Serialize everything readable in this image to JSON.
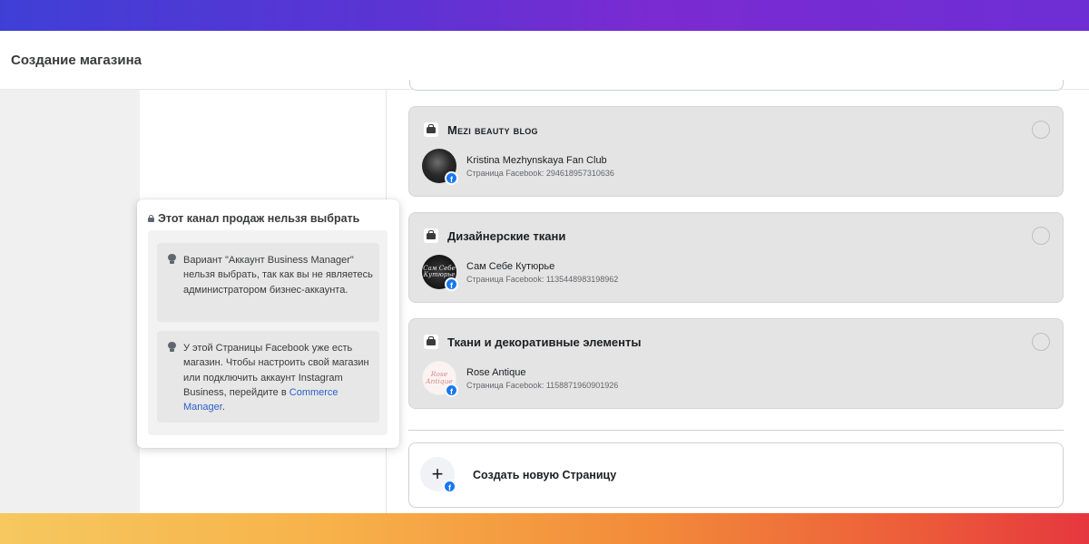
{
  "header": {
    "title": "Создание магазина"
  },
  "popup": {
    "title": "Этот канал продаж нельзя выбрать",
    "notes": [
      {
        "text": "Вариант \"Аккаунт Business Manager\" нельзя выбрать, так как вы не являетесь администратором бизнес-аккаунта."
      },
      {
        "text_before_link": "У этой Страницы Facebook уже есть магазин. Чтобы настроить свой магазин или подключить аккаунт Instagram Business, перейдите в ",
        "link": "Commerce Manager",
        "text_after_link": "."
      }
    ]
  },
  "shops": [
    {
      "name": "Mezi beauty blog",
      "page_name": "Kristina Mezhynskaya Fan Club",
      "page_id": "Страница Facebook: 294618957310636"
    },
    {
      "name": "Дизайнерские ткани",
      "page_name": "Сам Себе Кутюрье",
      "page_id": "Страница Facebook: 1135448983198962",
      "avatar_text": "Сам Себе Кутюрье"
    },
    {
      "name": "Ткани и декоративные элементы",
      "page_name": "Rose Antique",
      "page_id": "Страница Facebook: 1158871960901926",
      "avatar_text": "Rose Antique"
    }
  ],
  "create_page": {
    "label": "Создать новую Страницу",
    "icon": "plus-icon"
  },
  "icons": {
    "shop": "shop-icon",
    "facebook": "facebook-icon",
    "lock": "lock-icon",
    "bulb": "lightbulb-icon"
  },
  "colors": {
    "facebook_blue": "#1877f2",
    "link": "#2d5fc9",
    "card_disabled": "#e4e4e4"
  }
}
